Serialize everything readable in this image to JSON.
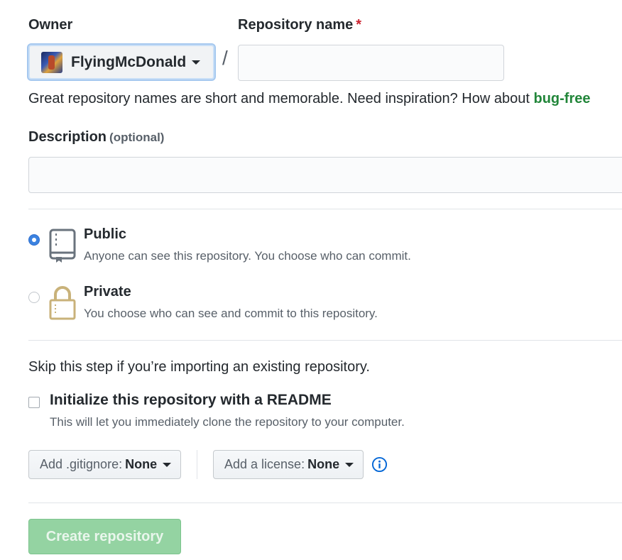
{
  "owner": {
    "label": "Owner",
    "selected": "FlyingMcDonald"
  },
  "repo_name": {
    "label": "Repository name",
    "required_mark": "*",
    "value": "",
    "separator": "/"
  },
  "hint": {
    "text": "Great repository names are short and memorable. Need inspiration? How about ",
    "suggestion": "bug-free"
  },
  "description": {
    "label": "Description",
    "optional": "(optional)",
    "value": ""
  },
  "visibility": {
    "public": {
      "title": "Public",
      "desc": "Anyone can see this repository. You choose who can commit.",
      "checked": true
    },
    "private": {
      "title": "Private",
      "desc": "You choose who can see and commit to this repository.",
      "checked": false
    }
  },
  "import": {
    "skip_text": "Skip this step if you’re importing an existing repository."
  },
  "readme": {
    "title": "Initialize this repository with a README",
    "desc": "This will let you immediately clone the repository to your computer.",
    "checked": false
  },
  "gitignore": {
    "label": "Add .gitignore:",
    "value": "None"
  },
  "license": {
    "label": "Add a license:",
    "value": "None"
  },
  "submit": {
    "label": "Create repository"
  },
  "colors": {
    "accent_blue": "#3b82e0",
    "suggestion_green": "#22863a",
    "create_button": "#94d3a2",
    "required_red": "#cb2431"
  }
}
